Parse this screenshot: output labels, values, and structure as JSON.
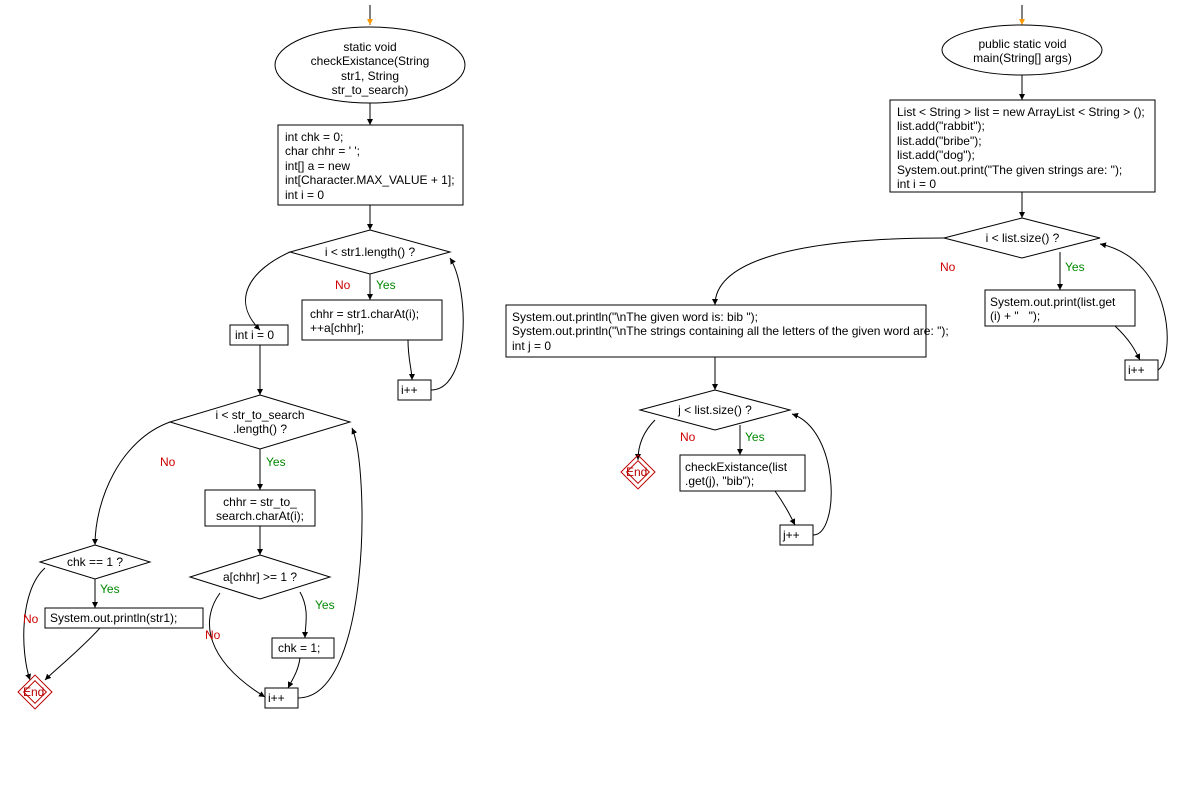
{
  "chart_data": {
    "type": "flowchart",
    "functions": [
      {
        "name": "checkExistance",
        "signature": "static void checkExistance(String str1, String str_to_search)",
        "entry_arrow": true,
        "steps": [
          {
            "id": "init1",
            "type": "process",
            "code": "int chk = 0;\nchar chhr = ' ';\nint[] a = new\nint[Character.MAX_VALUE + 1];\nint i = 0"
          },
          {
            "id": "cond1",
            "type": "decision",
            "code": "i < str1.length() ?",
            "yes": "loop1body",
            "no": "init2"
          },
          {
            "id": "loop1body",
            "type": "process",
            "code": "chhr = str1.charAt(i);\n++a[chhr];",
            "next": "inc1"
          },
          {
            "id": "inc1",
            "type": "process",
            "code": "i++",
            "next": "cond1"
          },
          {
            "id": "init2",
            "type": "process",
            "code": "int i = 0"
          },
          {
            "id": "cond2",
            "type": "decision",
            "code": "i < str_to_search\n.length() ?",
            "yes": "loop2body",
            "no": "cond3"
          },
          {
            "id": "loop2body",
            "type": "process",
            "code": "chhr = str_to_\nsearch.charAt(i);",
            "next": "cond4"
          },
          {
            "id": "cond4",
            "type": "decision",
            "code": "a[chhr] >= 1 ?",
            "yes": "setchk",
            "no": "inc2"
          },
          {
            "id": "setchk",
            "type": "process",
            "code": "chk = 1;",
            "next": "inc2"
          },
          {
            "id": "inc2",
            "type": "process",
            "code": "i++",
            "next": "cond2"
          },
          {
            "id": "cond3",
            "type": "decision",
            "code": "chk == 1 ?",
            "yes": "print1",
            "no": "end1"
          },
          {
            "id": "print1",
            "type": "process",
            "code": "System.out.println(str1);",
            "next": "end1"
          },
          {
            "id": "end1",
            "type": "terminator",
            "code": "End"
          }
        ]
      },
      {
        "name": "main",
        "signature": "public static void main(String[] args)",
        "entry_arrow": true,
        "steps": [
          {
            "id": "minit",
            "type": "process",
            "code": "List < String > list = new ArrayList < String > ();\nlist.add(\"rabbit\");\nlist.add(\"bribe\");\nlist.add(\"dog\");\nSystem.out.print(\"The given strings are: \");\nint i = 0"
          },
          {
            "id": "mcond1",
            "type": "decision",
            "code": "i < list.size() ?",
            "yes": "mprint1",
            "no": "mafter"
          },
          {
            "id": "mprint1",
            "type": "process",
            "code": "System.out.print(list.get\n(i) + \"   \");",
            "next": "minc1"
          },
          {
            "id": "minc1",
            "type": "process",
            "code": "i++",
            "next": "mcond1"
          },
          {
            "id": "mafter",
            "type": "process",
            "code": "System.out.println(\"\\nThe given word is: bib \");\nSystem.out.println(\"\\nThe strings containing all the letters of the given word are: \");\nint j = 0"
          },
          {
            "id": "mcond2",
            "type": "decision",
            "code": "j < list.size() ?",
            "yes": "mcall",
            "no": "mend"
          },
          {
            "id": "mcall",
            "type": "process",
            "code": "checkExistance(list\n.get(j), \"bib\");",
            "next": "minc2"
          },
          {
            "id": "minc2",
            "type": "process",
            "code": "j++",
            "next": "mcond2"
          },
          {
            "id": "mend",
            "type": "terminator",
            "code": "End"
          }
        ]
      }
    ]
  },
  "left": {
    "sig": "static void\ncheckExistance(String\nstr1, String\nstr_to_search)",
    "init1": "int chk = 0;\nchar chhr = ' ';\nint[] a = new\nint[Character.MAX_VALUE + 1];\nint i = 0",
    "cond1": "i < str1.length() ?",
    "loop1body": "chhr = str1.charAt(i);\n++a[chhr];",
    "inc1": "i++",
    "init2": "int i = 0",
    "cond2": "i < str_to_search\n.length() ?",
    "loop2body": "chhr = str_to_\nsearch.charAt(i);",
    "cond4": "a[chhr] >= 1 ?",
    "setchk": "chk = 1;",
    "inc2": "i++",
    "cond3": "chk == 1 ?",
    "print1": "System.out.println(str1);",
    "end1": "End"
  },
  "right": {
    "sig": "public static void\nmain(String[] args)",
    "minit": "List < String > list = new ArrayList < String > ();\nlist.add(\"rabbit\");\nlist.add(\"bribe\");\nlist.add(\"dog\");\nSystem.out.print(\"The given strings are: \");\nint i = 0",
    "mcond1": "i < list.size() ?",
    "mprint1": "System.out.print(list.get\n(i) + \"   \");",
    "minc1": "i++",
    "mafter": "System.out.println(\"\\nThe given word is: bib \");\nSystem.out.println(\"\\nThe strings containing all the letters of the given word are: \");\nint j = 0",
    "mcond2": "j < list.size() ?",
    "mcall": "checkExistance(list\n.get(j), \"bib\");",
    "minc2": "j++",
    "mend": "End"
  },
  "labels": {
    "yes": "Yes",
    "no": "No"
  }
}
